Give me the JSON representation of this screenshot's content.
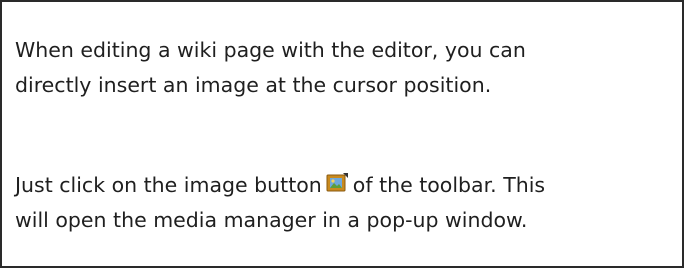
{
  "content": {
    "paragraph_1": {
      "line_1": "When editing a wiki page with the editor, you can",
      "line_2": "directly insert an image at the cursor position."
    },
    "paragraph_2": {
      "line_1_before_icon": "Just click on the image button",
      "line_1_after_icon": "of the toolbar. This",
      "line_2": "will open the media manager in a pop-up window.",
      "toolbar_icon": "image-icon"
    }
  },
  "colors": {
    "text": "#1f1f1f",
    "border": "#2a2a2a",
    "icon_frame": "#c98a1e",
    "icon_sky": "#6fa8dc",
    "icon_land": "#5e9e3a"
  }
}
